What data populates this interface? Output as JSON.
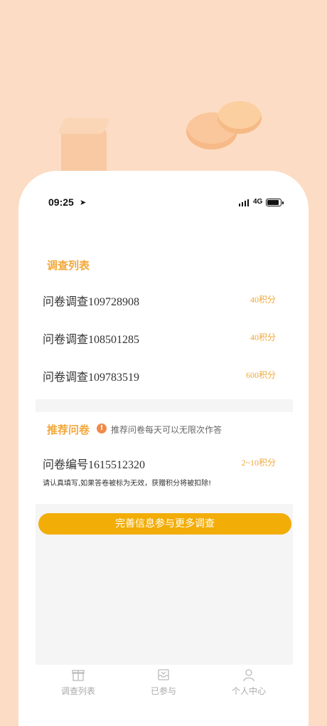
{
  "status_bar": {
    "time": "09:25",
    "network": "4G"
  },
  "survey_list": {
    "title": "调查列表",
    "items": [
      {
        "name": "问卷调查109728908",
        "points": "40积分"
      },
      {
        "name": "问卷调查108501285",
        "points": "40积分"
      },
      {
        "name": "问卷调查109783519",
        "points": "600积分"
      }
    ]
  },
  "recommended": {
    "title": "推荐问卷",
    "hint": "推荐问卷每天可以无限次作答",
    "item": {
      "name": "问卷编号1615512320",
      "points": "2~10积分"
    },
    "notice": "请认真填写,如果答卷被标为无效，获赠积分将被扣除!"
  },
  "cta_label": "完善信息参与更多调查",
  "tabs": [
    {
      "label": "调查列表",
      "icon": "gift-icon"
    },
    {
      "label": "已参与",
      "icon": "inbox-icon"
    },
    {
      "label": "个人中心",
      "icon": "person-icon"
    }
  ],
  "colors": {
    "accent": "#f2a83a",
    "button": "#f2ad07",
    "background": "#fcdcc4"
  }
}
